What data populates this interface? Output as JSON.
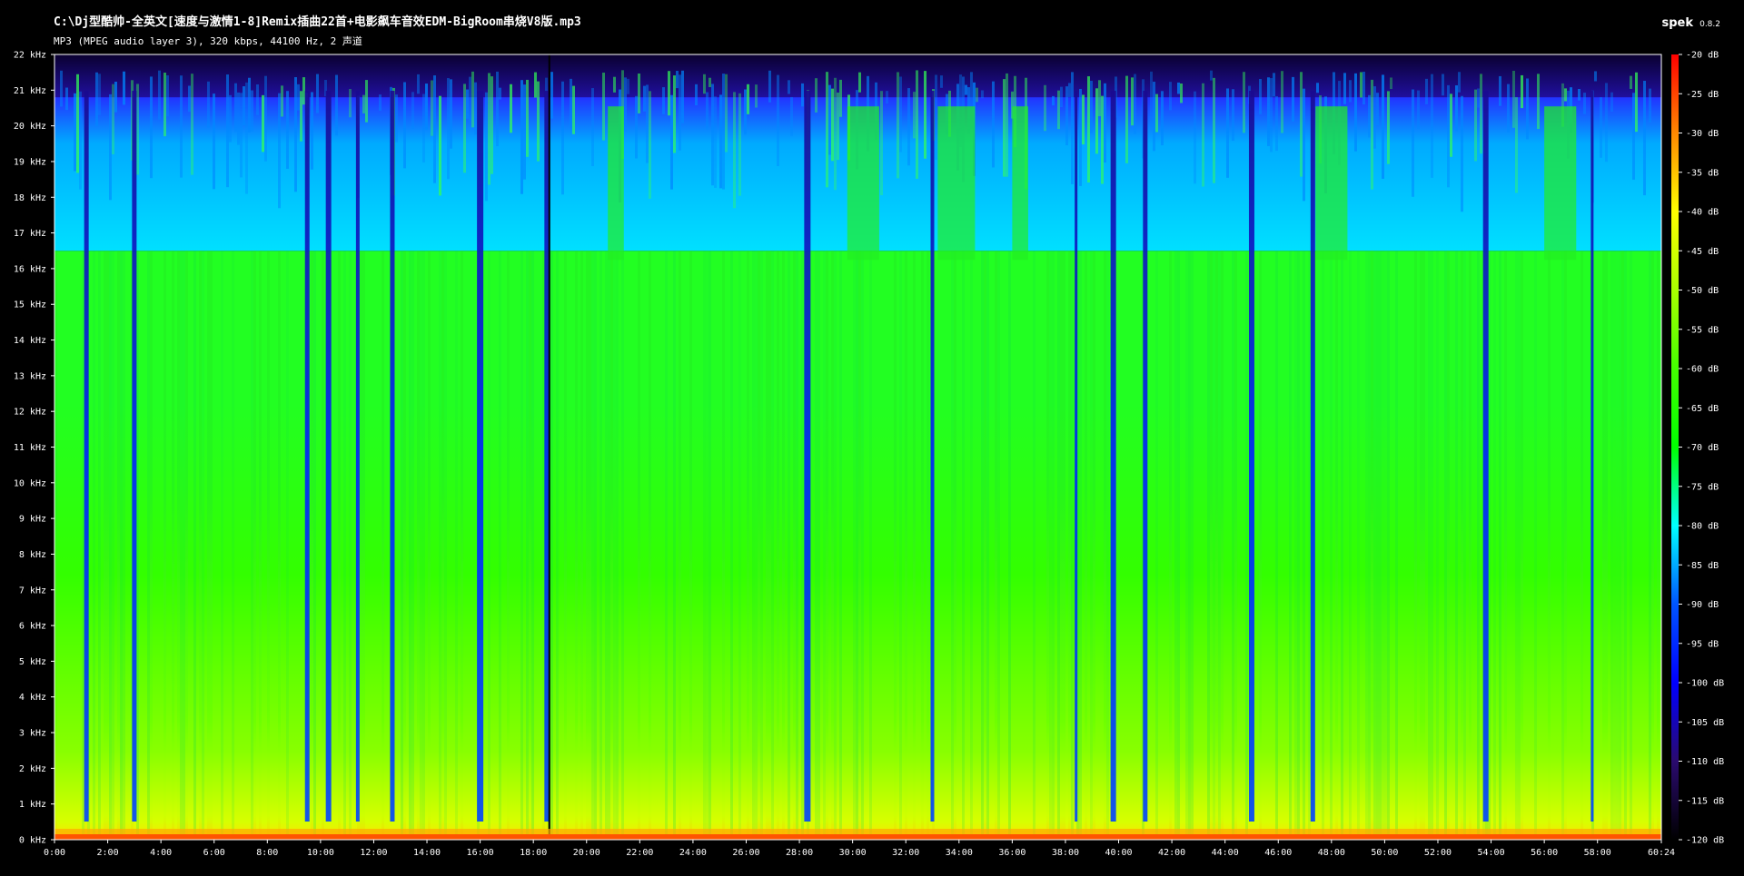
{
  "header": {
    "file_title": "C:\\Dj型酷帅-全英文[速度与激情1-8]Remix插曲22首+电影飙车音效EDM-BigRoom串烧V8版.mp3",
    "file_info": "MP3 (MPEG audio layer 3), 320 kbps, 44100 Hz, 2 声道",
    "app_name": "spek",
    "app_version": "0.8.2"
  },
  "chart_data": {
    "type": "heatmap",
    "title": "",
    "xlabel": "",
    "ylabel": "",
    "x_unit": "time (mm:ss)",
    "y_unit": "kHz",
    "xlim": [
      "0:00",
      "60:24"
    ],
    "ylim_khz": [
      0,
      22
    ],
    "x_ticks": [
      "0:00",
      "2:00",
      "4:00",
      "6:00",
      "8:00",
      "10:00",
      "12:00",
      "14:00",
      "16:00",
      "18:00",
      "20:00",
      "22:00",
      "24:00",
      "26:00",
      "28:00",
      "30:00",
      "32:00",
      "34:00",
      "36:00",
      "38:00",
      "40:00",
      "42:00",
      "44:00",
      "46:00",
      "48:00",
      "50:00",
      "52:00",
      "54:00",
      "56:00",
      "58:00",
      "60:24"
    ],
    "x_tick_minutes": [
      0,
      2,
      4,
      6,
      8,
      10,
      12,
      14,
      16,
      18,
      20,
      22,
      24,
      26,
      28,
      30,
      32,
      34,
      36,
      38,
      40,
      42,
      44,
      46,
      48,
      50,
      52,
      54,
      56,
      58,
      60.4
    ],
    "x_max_minutes": 60.4,
    "y_ticks": [
      "0 kHz",
      "1 kHz",
      "2 kHz",
      "3 kHz",
      "4 kHz",
      "5 kHz",
      "6 kHz",
      "7 kHz",
      "8 kHz",
      "9 kHz",
      "10 kHz",
      "11 kHz",
      "12 kHz",
      "13 kHz",
      "14 kHz",
      "15 kHz",
      "16 kHz",
      "17 kHz",
      "18 kHz",
      "19 kHz",
      "20 kHz",
      "21 kHz",
      "22 kHz"
    ],
    "y_tick_khz": [
      0,
      1,
      2,
      3,
      4,
      5,
      6,
      7,
      8,
      9,
      10,
      11,
      12,
      13,
      14,
      15,
      16,
      17,
      18,
      19,
      20,
      21,
      22
    ],
    "colorbar": {
      "range_db": [
        -120,
        -20
      ],
      "ticks": [
        "-20 dB",
        "-25 dB",
        "-30 dB",
        "-35 dB",
        "-40 dB",
        "-45 dB",
        "-50 dB",
        "-55 dB",
        "-60 dB",
        "-65 dB",
        "-70 dB",
        "-75 dB",
        "-80 dB",
        "-85 dB",
        "-90 dB",
        "-95 dB",
        "-100 dB",
        "-105 dB",
        "-110 dB",
        "-115 dB",
        "-120 dB"
      ],
      "tick_db": [
        -20,
        -25,
        -30,
        -35,
        -40,
        -45,
        -50,
        -55,
        -60,
        -65,
        -70,
        -75,
        -80,
        -85,
        -90,
        -95,
        -100,
        -105,
        -110,
        -115,
        -120
      ],
      "stops": [
        {
          "db": -120,
          "color": "#000000"
        },
        {
          "db": -110,
          "color": "#2a0a6e"
        },
        {
          "db": -100,
          "color": "#0000ff"
        },
        {
          "db": -90,
          "color": "#0055ff"
        },
        {
          "db": -80,
          "color": "#00ffff"
        },
        {
          "db": -70,
          "color": "#00ff00"
        },
        {
          "db": -60,
          "color": "#44ff00"
        },
        {
          "db": -50,
          "color": "#aaff00"
        },
        {
          "db": -40,
          "color": "#ffff00"
        },
        {
          "db": -30,
          "color": "#ff8800"
        },
        {
          "db": -20,
          "color": "#ff0000"
        }
      ]
    },
    "lowpass_cutoff_khz_approx": 16.5,
    "high_band_extent_khz_approx": 20.8,
    "dropout_positions_minutes_approx": [
      1.2,
      3.0,
      9.5,
      10.3,
      11.4,
      12.7,
      16.0,
      18.5,
      28.3,
      33.0,
      38.4,
      39.8,
      41.0,
      45.0,
      47.3,
      53.8,
      57.8
    ],
    "silence_gap_minutes_approx": 18.6
  }
}
